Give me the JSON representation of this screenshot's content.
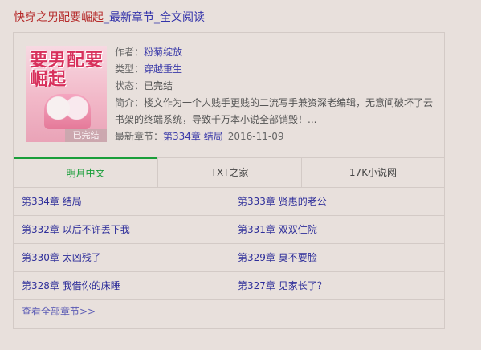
{
  "header": {
    "book_title": "快穿之男配要崛起",
    "sep1": "_",
    "latest_link": "最新章节",
    "sep2": "_",
    "fulltext_link": "全文阅读"
  },
  "book": {
    "cover_title": "要男配要崛起",
    "cover_status": "已完结",
    "author_label": "作者：",
    "author": "粉菊绽放",
    "type_label": "类型：",
    "type": "穿越重生",
    "status_label": "状态：",
    "status": "已完结",
    "intro_label": "简介：",
    "intro": "楼文作为一个人贱手更贱的二流写手兼资深老编辑，无意间破坏了云书架的终端系统，导致千万本小说全部销毁！...",
    "latest_label": "最新章节：",
    "latest_chapter": "第334章 结局",
    "latest_date": "2016-11-09"
  },
  "tabs": [
    {
      "label": "明月中文"
    },
    {
      "label": "TXT之家"
    },
    {
      "label": "17K小说网"
    }
  ],
  "chapters": [
    {
      "left": "第334章 结局",
      "right": "第333章 贤惠的老公"
    },
    {
      "left": "第332章 以后不许丢下我",
      "right": "第331章 双双住院"
    },
    {
      "left": "第330章 太凶残了",
      "right": "第329章 臭不要脸"
    },
    {
      "left": "第328章 我借你的床睡",
      "right": "第327章 见家长了？"
    }
  ],
  "all_chapters_link": "查看全部章节>>",
  "colors": {
    "background": "#e8e0dc",
    "title_red": "#b52a2a",
    "link_blue": "#3333aa",
    "active_tab_green": "#1a9e3a"
  }
}
